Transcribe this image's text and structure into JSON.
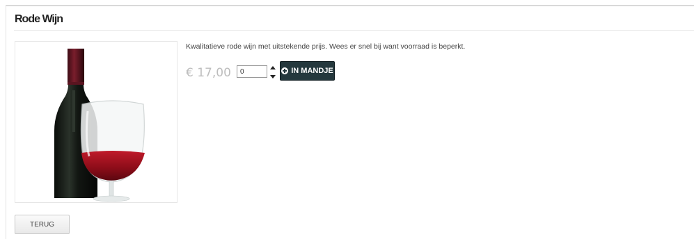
{
  "product": {
    "title": "Rode Wijn",
    "description": "Kwalitatieve rode wijn met uitstekende prijs.  Wees er snel bij want voorraad is beperkt.",
    "price": "€ 17,00",
    "quantity": "0",
    "add_to_cart_label": "IN MANDJE",
    "image": "red-wine-bottle-and-glass"
  },
  "actions": {
    "back_label": "TERUG"
  },
  "colors": {
    "button_dark": "#24383d",
    "price_grey": "#bdbdbd"
  }
}
